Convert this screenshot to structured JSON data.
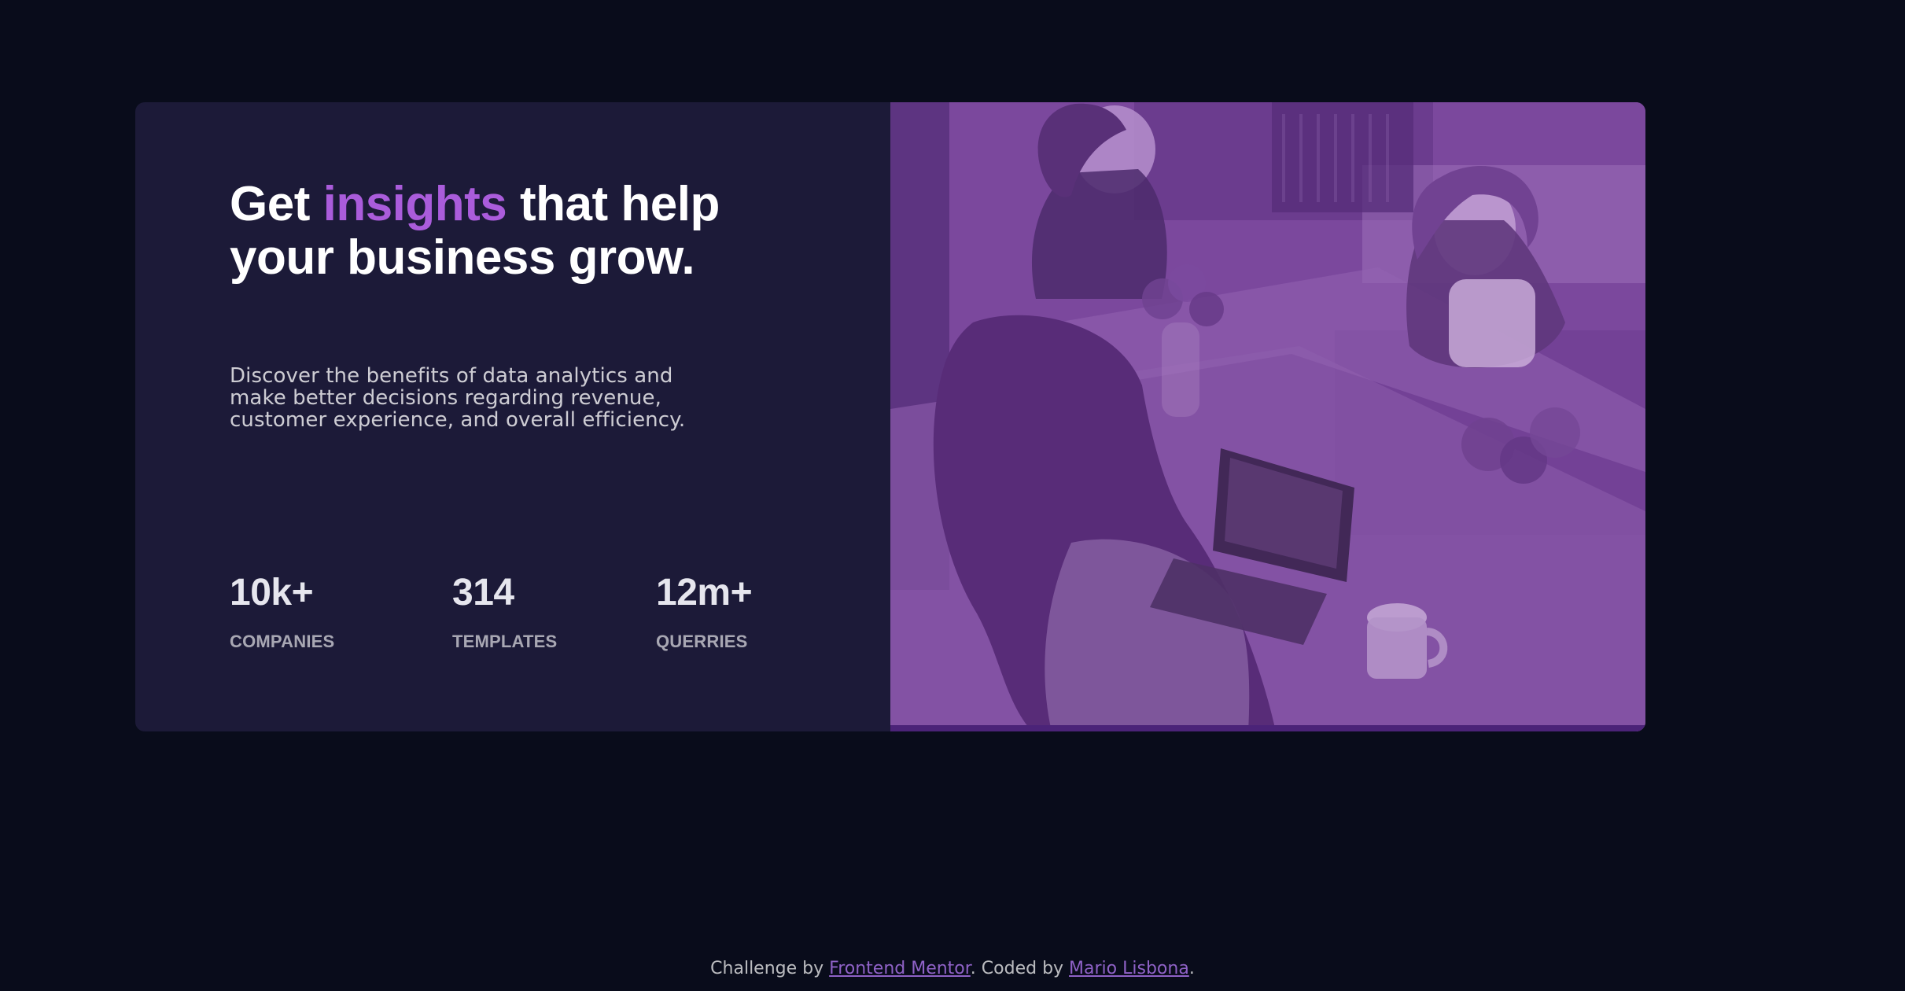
{
  "hero": {
    "headline_prefix": "Get ",
    "headline_accent": "insights",
    "headline_suffix": " that help your business grow.",
    "description": "Discover the benefits of data analytics and make better decisions regarding revenue, customer experience, and overall efficiency."
  },
  "stats": [
    {
      "value": "10k+",
      "label": "COMPANIES"
    },
    {
      "value": "314",
      "label": "TEMPLATES"
    },
    {
      "value": "12m+",
      "label": "QUERRIES"
    }
  ],
  "footer": {
    "prefix": "Challenge by ",
    "link_one_text": "Frontend Mentor",
    "middle": ". Coded by ",
    "link_two_text": "Mario Lisbona",
    "suffix": "."
  },
  "colors": {
    "background": "#090c1b",
    "card": "#1c1a38",
    "accent": "#aa5cdb",
    "overlay": "#7d4aa0"
  },
  "icons": {
    "image_placeholder": "office-team-photo-icon"
  }
}
